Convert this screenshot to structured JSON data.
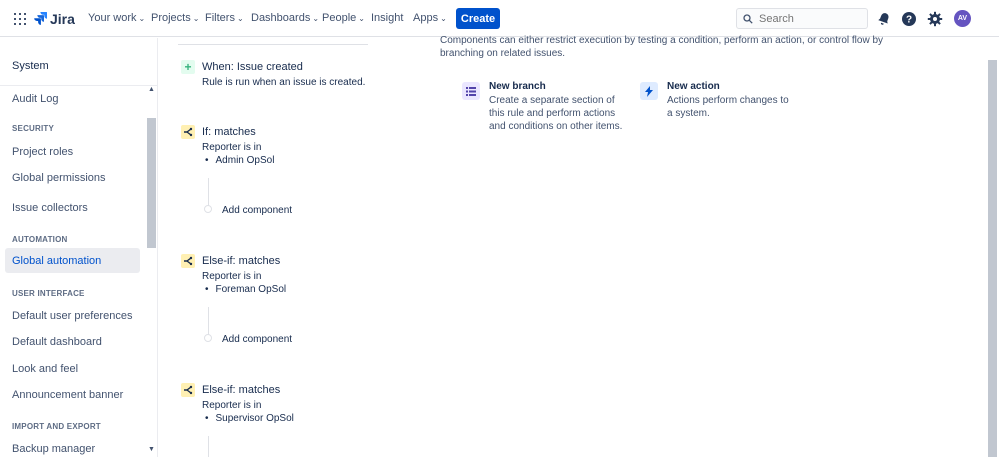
{
  "header": {
    "brand": "Jira",
    "nav": [
      {
        "label": "Your work",
        "dropdown": true
      },
      {
        "label": "Projects",
        "dropdown": true
      },
      {
        "label": "Filters",
        "dropdown": true
      },
      {
        "label": "Dashboards",
        "dropdown": true
      },
      {
        "label": "People",
        "dropdown": true
      },
      {
        "label": "Insight",
        "dropdown": false
      },
      {
        "label": "Apps",
        "dropdown": true
      }
    ],
    "create_label": "Create",
    "search_placeholder": "Search",
    "avatar_initials": "AV",
    "accent": "#0052cc"
  },
  "sidebar": {
    "title": "System",
    "items": {
      "audit_log": "Audit Log",
      "security_head": "SECURITY",
      "project_roles": "Project roles",
      "global_permissions": "Global permissions",
      "issue_collectors": "Issue collectors",
      "automation_head": "AUTOMATION",
      "global_automation": "Global automation",
      "ui_head": "USER INTERFACE",
      "default_user_prefs": "Default user preferences",
      "default_dashboard": "Default dashboard",
      "look_and_feel": "Look and feel",
      "announcement_banner": "Announcement banner",
      "import_export_head": "IMPORT AND EXPORT",
      "backup_manager": "Backup manager"
    }
  },
  "flow": {
    "trigger": {
      "title": "When: Issue created",
      "desc": "Rule is run when an issue is created."
    },
    "conditions": [
      {
        "title": "If: matches",
        "desc": "Reporter is in",
        "value": "Admin OpSol",
        "add": "Add component"
      },
      {
        "title": "Else-if: matches",
        "desc": "Reporter is in",
        "value": "Foreman OpSol",
        "add": "Add component"
      },
      {
        "title": "Else-if: matches",
        "desc": "Reporter is in",
        "value": "Supervisor OpSol"
      }
    ]
  },
  "main": {
    "intro": "Components can either restrict execution by testing a condition, perform an action, or control flow by branching on related issues.",
    "cards": [
      {
        "title": "New branch",
        "desc": "Create a separate section of this rule and perform actions and conditions on other items.",
        "icon": "list-icon"
      },
      {
        "title": "New action",
        "desc": "Actions perform changes to a system.",
        "icon": "lightning-icon"
      }
    ]
  }
}
